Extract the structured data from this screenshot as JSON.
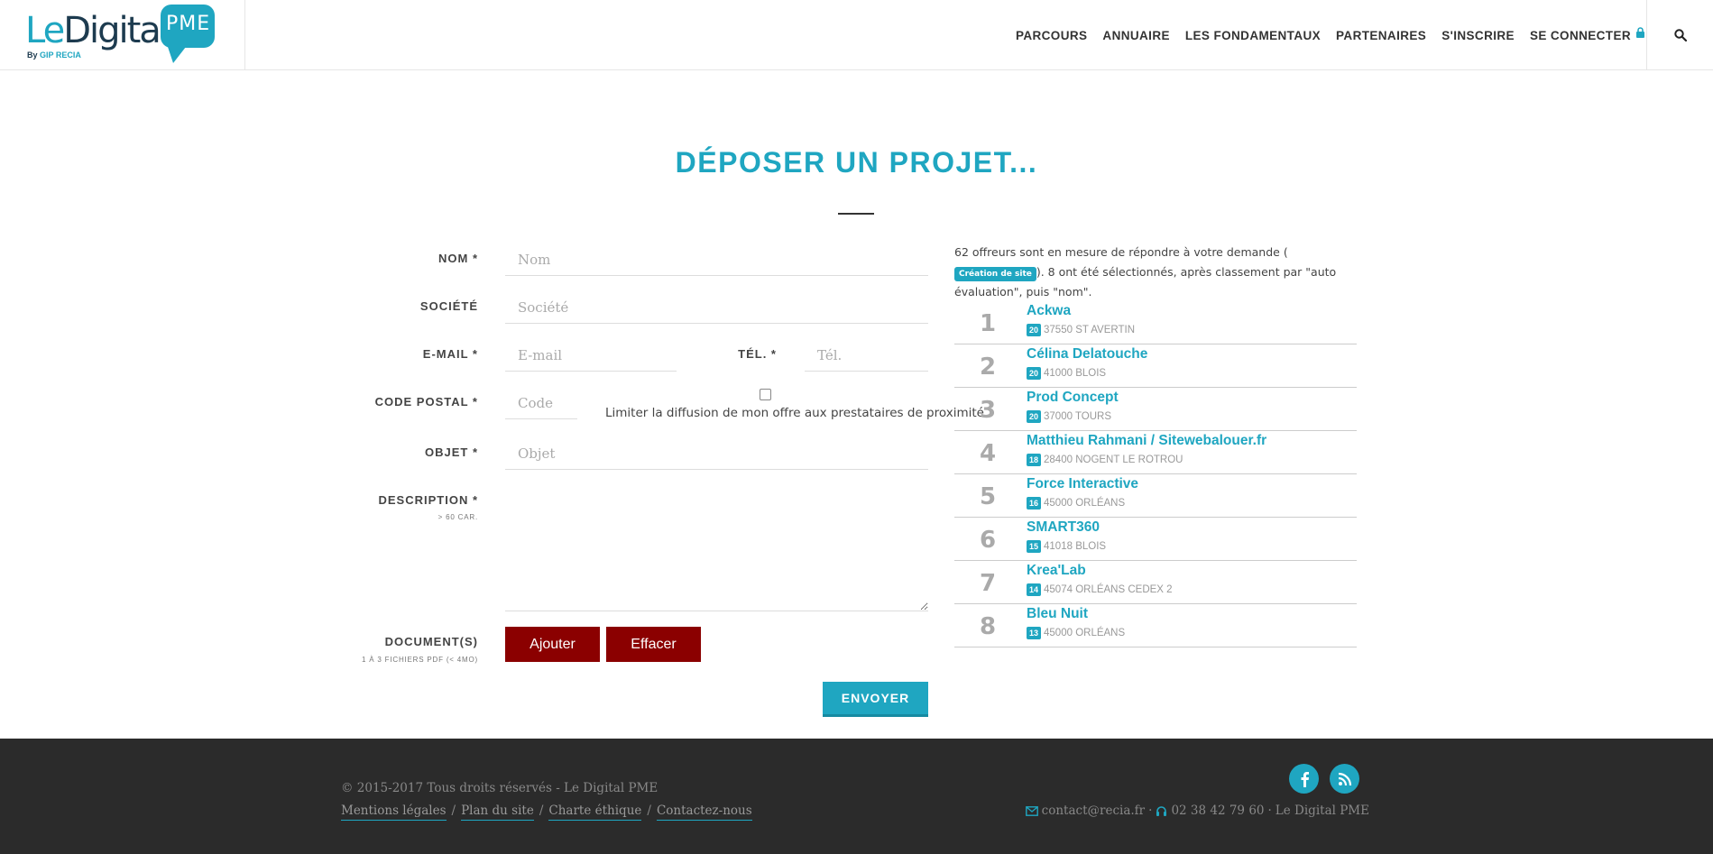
{
  "header": {
    "logo": {
      "le": "Le",
      "digital": "Digital",
      "pme": "PME",
      "by": "By",
      "gip": "GIP RECIA"
    },
    "nav": [
      {
        "label": "PARCOURS"
      },
      {
        "label": "ANNUAIRE"
      },
      {
        "label": "LES FONDAMENTAUX"
      },
      {
        "label": "PARTENAIRES"
      },
      {
        "label": "S'INSCRIRE"
      },
      {
        "label": "SE CONNECTER"
      }
    ]
  },
  "page": {
    "title": "DÉPOSER UN PROJET..."
  },
  "form": {
    "nom": {
      "label": "NOM *",
      "placeholder": "Nom"
    },
    "societe": {
      "label": "SOCIÉTÉ",
      "placeholder": "Société"
    },
    "email": {
      "label": "E-MAIL *",
      "placeholder": "E-mail"
    },
    "tel": {
      "label": "TÉL. *",
      "placeholder": "Tél."
    },
    "code_postal": {
      "label": "CODE POSTAL *",
      "placeholder": "Code"
    },
    "limit_checkbox": {
      "label": "Limiter la diffusion de mon offre aux prestataires de proximité",
      "checked": false
    },
    "objet": {
      "label": "OBJET *",
      "placeholder": "Objet"
    },
    "description": {
      "label": "DESCRIPTION *",
      "hint": "> 60 CAR."
    },
    "documents": {
      "label": "DOCUMENT(S)",
      "hint": "1 À 3 FICHIERS PDF (< 4MO)"
    },
    "add_button": "Ajouter",
    "clear_button": "Effacer",
    "submit_button": "ENVOYER"
  },
  "results": {
    "intro_before": "62 offreurs sont en mesure de répondre à votre demande (",
    "category_tag": "Création de site",
    "intro_after": "). 8 ont été sélectionnés, après classement par \"auto évaluation\", puis \"nom\".",
    "items": [
      {
        "rank": "1",
        "name": "Ackwa",
        "score": "20",
        "location": "37550 ST AVERTIN"
      },
      {
        "rank": "2",
        "name": "Célina Delatouche",
        "score": "20",
        "location": "41000 BLOIS"
      },
      {
        "rank": "3",
        "name": "Prod Concept",
        "score": "20",
        "location": "37000 TOURS"
      },
      {
        "rank": "4",
        "name": "Matthieu Rahmani / Sitewebalouer.fr",
        "score": "18",
        "location": "28400 NOGENT LE ROTROU"
      },
      {
        "rank": "5",
        "name": "Force Interactive",
        "score": "16",
        "location": "45000 ORLÉANS"
      },
      {
        "rank": "6",
        "name": "SMART360",
        "score": "15",
        "location": "41018 BLOIS"
      },
      {
        "rank": "7",
        "name": "Krea'Lab",
        "score": "14",
        "location": "45074 ORLÉANS CEDEX 2"
      },
      {
        "rank": "8",
        "name": "Bleu Nuit",
        "score": "13",
        "location": "45000 ORLÉANS"
      }
    ]
  },
  "footer": {
    "copyright": "© 2015-2017 Tous droits réservés - Le Digital PME",
    "links": [
      "Mentions légales",
      "Plan du site",
      "Charte éthique",
      "Contactez-nous"
    ],
    "separator": "/",
    "email": "contact@recia.fr",
    "phone": "02 38 42 79 60",
    "brand": "Le Digital PME",
    "dot": "·"
  },
  "colors": {
    "accent": "#1fa6c1",
    "button_red": "#8b0000",
    "footer_bg": "#2b2b2b"
  },
  "icons": [
    "lock-icon",
    "search-icon",
    "facebook-icon",
    "rss-icon",
    "envelope-icon",
    "headset-icon"
  ]
}
